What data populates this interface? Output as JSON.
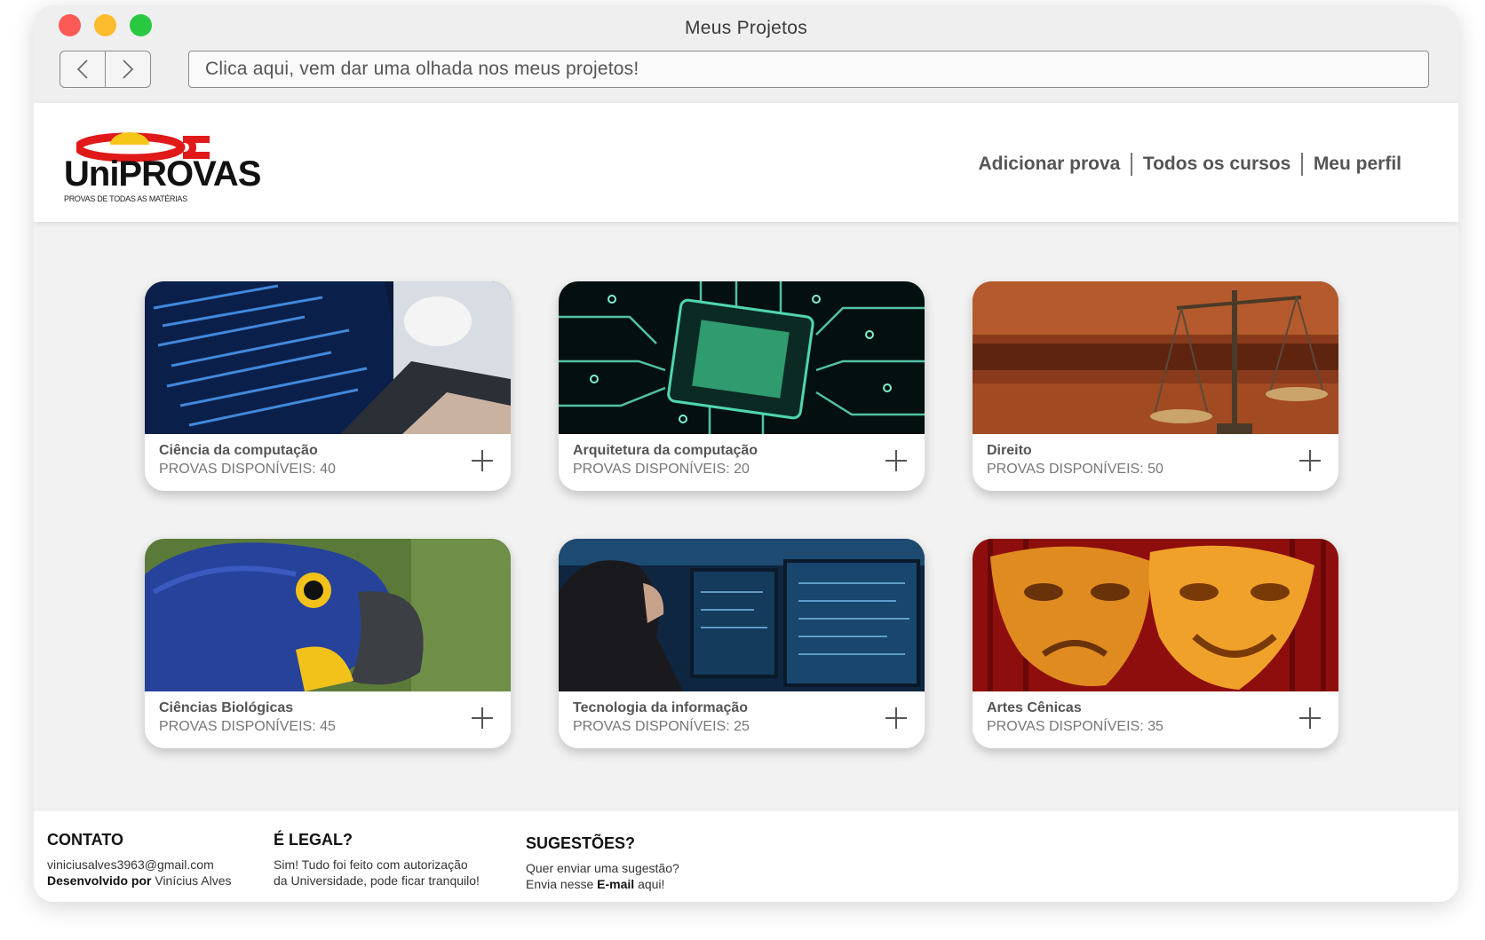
{
  "window": {
    "title": "Meus Projetos",
    "address_text": "Clica aqui, vem dar uma olhada nos meus projetos!"
  },
  "header": {
    "logo_text": "UNIPROVAS",
    "logo_brand": "UniPROVAS",
    "logo_tagline": "PROVAS DE TODAS AS MATÉRIAS",
    "nav": [
      "Adicionar prova",
      "Todos os cursos",
      "Meu perfil"
    ]
  },
  "cards": [
    {
      "name": "Ciência da computação",
      "count": "PROVAS DISPONÍVEIS: 40",
      "image": "laptop-code-photo"
    },
    {
      "name": "Arquitetura da computação",
      "count": "PROVAS DISPONÍVEIS: 20",
      "image": "circuit-chip-photo"
    },
    {
      "name": "Direito",
      "count": "PROVAS DISPONÍVEIS: 50",
      "image": "justice-scale-photo"
    },
    {
      "name": "Ciências Biológicas",
      "count": "PROVAS DISPONÍVEIS: 45",
      "image": "blue-macaw-photo"
    },
    {
      "name": "Tecnologia da informação",
      "count": "PROVAS DISPONÍVEIS: 25",
      "image": "monitors-woman-photo"
    },
    {
      "name": "Artes Cênicas",
      "count": "PROVAS DISPONÍVEIS: 35",
      "image": "theater-masks-photo"
    }
  ],
  "footer": {
    "contact": {
      "heading": "CONTATO",
      "email": "viniciusalves3963@gmail.com",
      "dev_label": "Desenvolvido por",
      "dev_name": "Vinícius Alves"
    },
    "legal": {
      "heading": "É LEGAL?",
      "line1": "Sim! Tudo foi feito com autorização",
      "line2": "da Universidade, pode ficar tranquilo!"
    },
    "suggest": {
      "heading": "SUGESTÕES?",
      "line1": "Quer enviar uma sugestão?",
      "line2_pre": "Envia nesse",
      "line2_link": "E-mail",
      "line2_post": "aqui!"
    }
  },
  "colors": {
    "traffic_red": "#fc5a57",
    "traffic_yellow": "#fdbb2e",
    "traffic_green": "#28c840",
    "logo_red": "#e01919",
    "logo_yellow": "#f5c518"
  }
}
